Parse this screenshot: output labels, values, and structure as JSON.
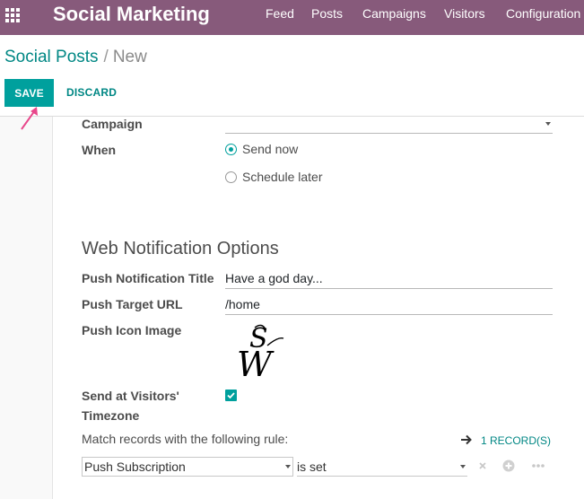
{
  "navbar": {
    "app_title": "Social Marketing",
    "menu": [
      "Feed",
      "Posts",
      "Campaigns",
      "Visitors",
      "Configuration"
    ]
  },
  "breadcrumb": {
    "parent": "Social Posts",
    "separator": "/",
    "current": "New"
  },
  "buttons": {
    "save": "SAVE",
    "discard": "DISCARD"
  },
  "form": {
    "campaign_label": "Campaign",
    "campaign_value": "",
    "when_label": "When",
    "when_options": [
      "Send now",
      "Schedule later"
    ],
    "when_selected": "Send now",
    "section_title": "Web Notification Options",
    "push_title_label": "Push Notification Title",
    "push_title_value": "Have a god day...",
    "push_url_label": "Push Target URL",
    "push_url_value": "/home",
    "push_icon_label": "Push Icon Image",
    "push_icon_logo_text": "SW",
    "timezone_label_line1": "Send at Visitors'",
    "timezone_label_line2": "Timezone",
    "timezone_checked": true,
    "rule_text": "Match records with the following rule:",
    "records_link": "1 RECORD(S)",
    "rule_field": "Push Subscription",
    "rule_operator": "is set"
  },
  "colors": {
    "navbar": "#875a7b",
    "primary": "#00a09d",
    "link": "#008784"
  },
  "icons": [
    "apps-grid-icon",
    "arrow-right-icon",
    "remove-icon",
    "add-icon",
    "more-icon"
  ]
}
